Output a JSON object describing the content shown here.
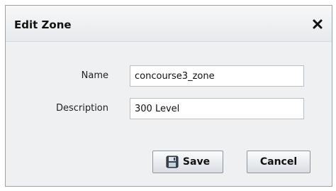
{
  "dialog": {
    "title": "Edit Zone",
    "close_icon": "close-icon"
  },
  "form": {
    "name_label": "Name",
    "name_value": "concourse3_zone",
    "description_label": "Description",
    "description_value": "300 Level"
  },
  "buttons": {
    "save_label": "Save",
    "save_icon": "save-icon",
    "cancel_label": "Cancel"
  }
}
